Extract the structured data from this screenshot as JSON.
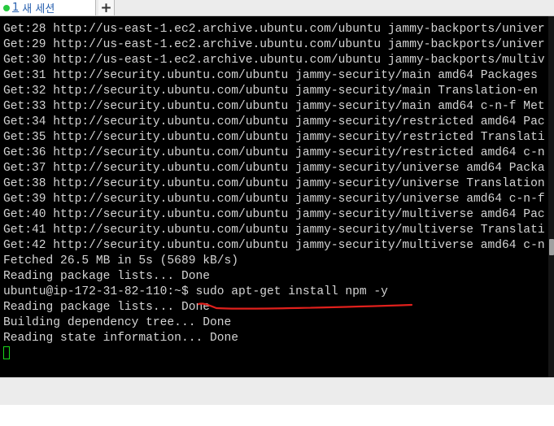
{
  "tab": {
    "number": "1",
    "title": "새 세션",
    "add_label": "+"
  },
  "terminal": {
    "lines": [
      "Get:28 http://us-east-1.ec2.archive.ubuntu.com/ubuntu jammy-backports/univer",
      "Get:29 http://us-east-1.ec2.archive.ubuntu.com/ubuntu jammy-backports/univer",
      "Get:30 http://us-east-1.ec2.archive.ubuntu.com/ubuntu jammy-backports/multiv",
      "Get:31 http://security.ubuntu.com/ubuntu jammy-security/main amd64 Packages",
      "Get:32 http://security.ubuntu.com/ubuntu jammy-security/main Translation-en",
      "Get:33 http://security.ubuntu.com/ubuntu jammy-security/main amd64 c-n-f Met",
      "Get:34 http://security.ubuntu.com/ubuntu jammy-security/restricted amd64 Pac",
      "Get:35 http://security.ubuntu.com/ubuntu jammy-security/restricted Translati",
      "Get:36 http://security.ubuntu.com/ubuntu jammy-security/restricted amd64 c-n",
      "Get:37 http://security.ubuntu.com/ubuntu jammy-security/universe amd64 Packa",
      "Get:38 http://security.ubuntu.com/ubuntu jammy-security/universe Translation",
      "Get:39 http://security.ubuntu.com/ubuntu jammy-security/universe amd64 c-n-f",
      "Get:40 http://security.ubuntu.com/ubuntu jammy-security/multiverse amd64 Pac",
      "Get:41 http://security.ubuntu.com/ubuntu jammy-security/multiverse Translati",
      "Get:42 http://security.ubuntu.com/ubuntu jammy-security/multiverse amd64 c-n",
      "Fetched 26.5 MB in 5s (5689 kB/s)",
      "Reading package lists... Done",
      "ubuntu@ip-172-31-82-110:~$ sudo apt-get install npm -y",
      "Reading package lists... Done",
      "Building dependency tree... Done",
      "Reading state information... Done"
    ]
  },
  "colors": {
    "terminal_bg": "#000000",
    "terminal_text": "#d4d4d4",
    "cursor": "#19d519",
    "annotation": "#e0201c"
  },
  "icons": {
    "tab_status": "status-dot-icon",
    "add_tab": "plus-icon"
  }
}
